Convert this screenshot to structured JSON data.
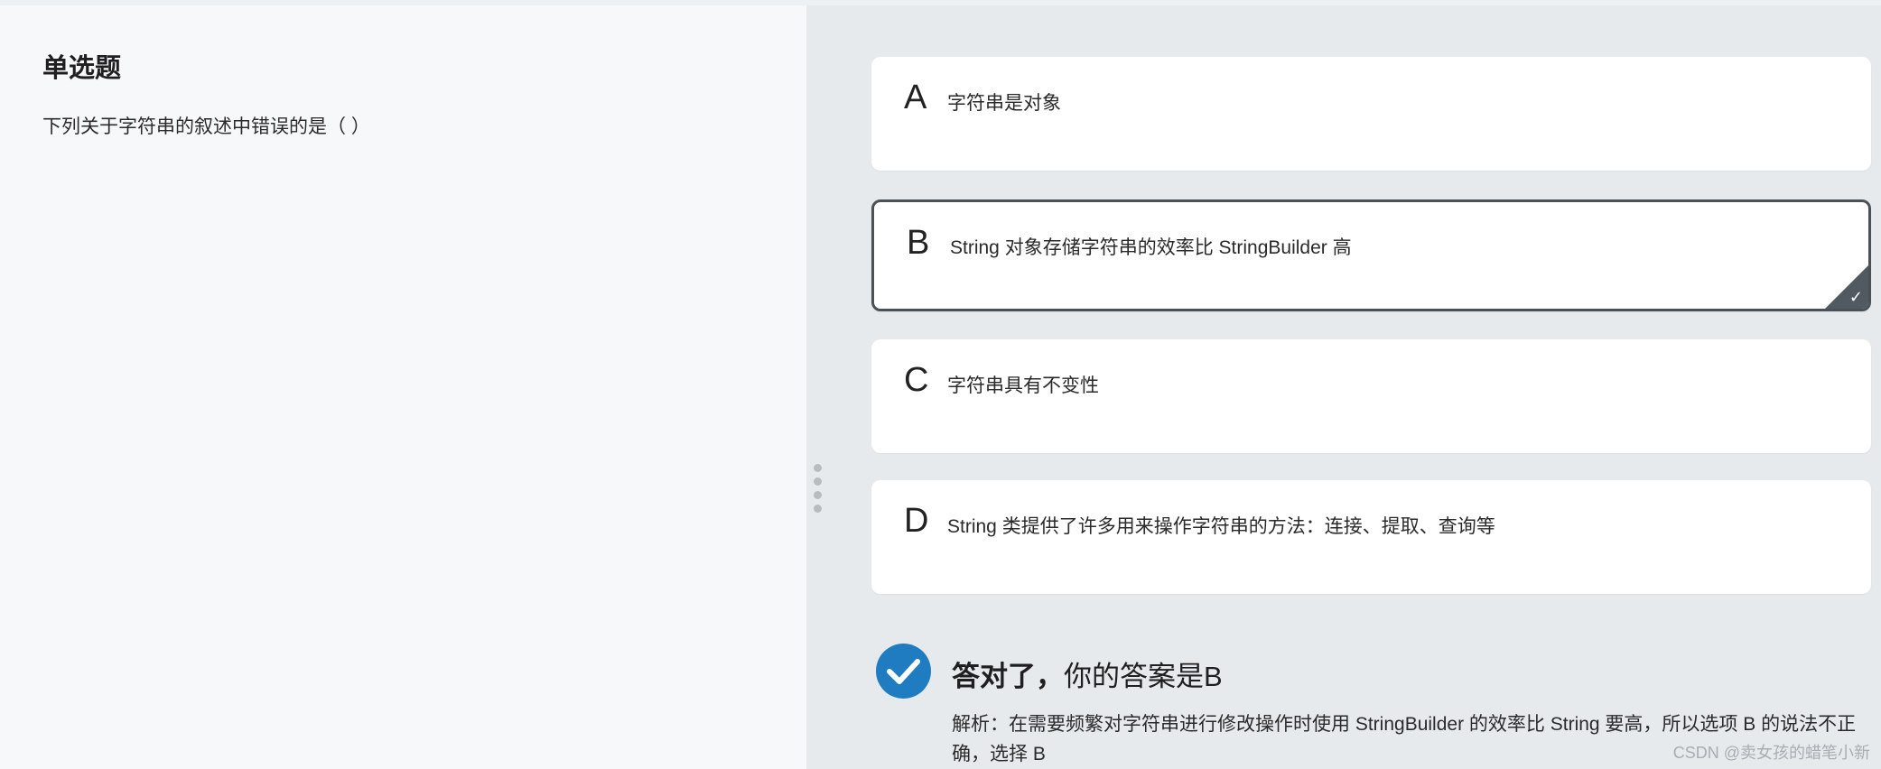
{
  "question": {
    "type_label": "单选题",
    "stem": "下列关于字符串的叙述中错误的是（ ）"
  },
  "options": [
    {
      "letter": "A",
      "text": "字符串是对象",
      "selected": false
    },
    {
      "letter": "B",
      "text": "String 对象存储字符串的效率比 StringBuilder 高",
      "selected": true
    },
    {
      "letter": "C",
      "text": "字符串具有不变性",
      "selected": false
    },
    {
      "letter": "D",
      "text": "String 类提供了许多用来操作字符串的方法：连接、提取、查询等",
      "selected": false
    }
  ],
  "result": {
    "status_strong": "答对了，",
    "status_rest": "你的答案是B",
    "explanation": "解析：在需要频繁对字符串进行修改操作时使用 StringBuilder 的效率比 String 要高，所以选项 B 的说法不正确，选择 B",
    "icon": "check-circle-icon",
    "icon_color": "#1f7cc0"
  },
  "selected_check_icon": "check-icon",
  "watermark": "CSDN @卖女孩的蜡笔小新"
}
